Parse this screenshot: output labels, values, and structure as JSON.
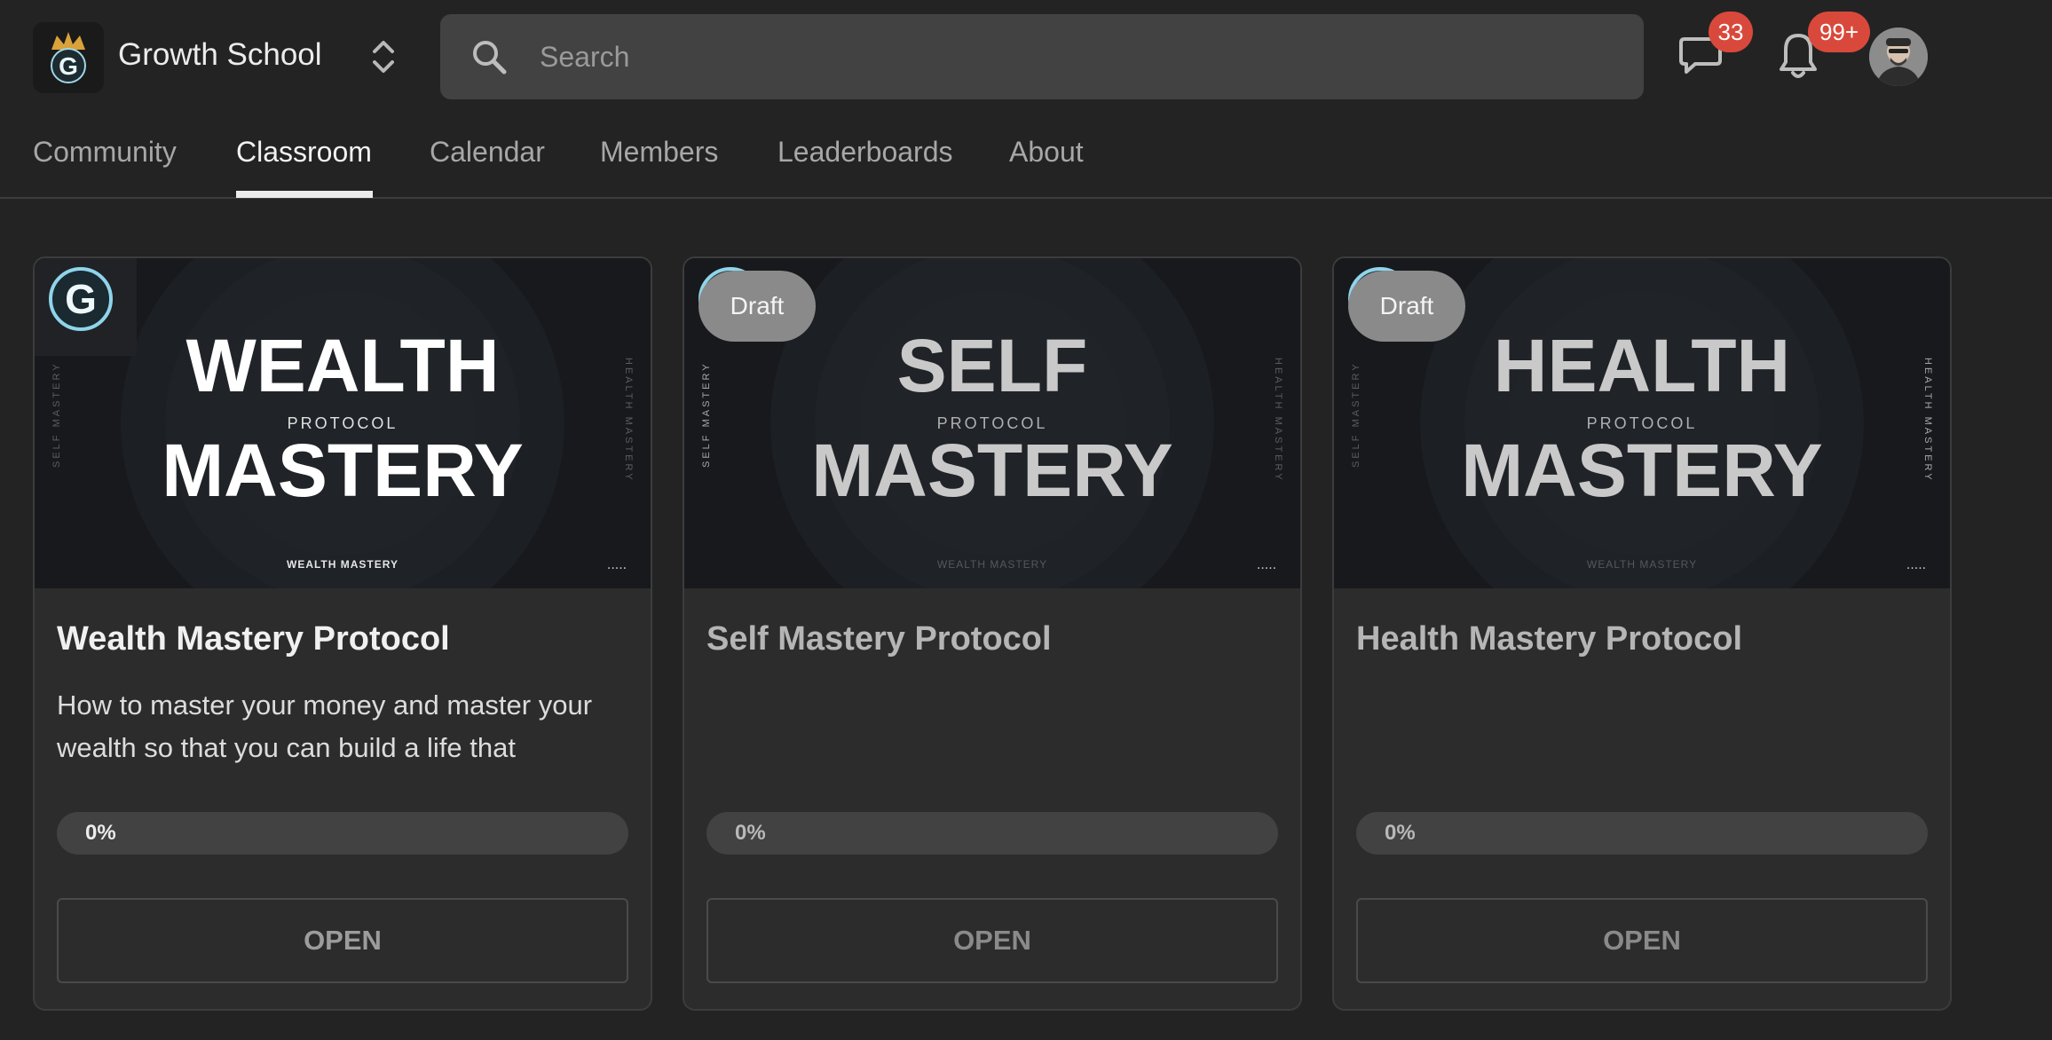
{
  "header": {
    "app_name": "Growth School",
    "search_placeholder": "Search",
    "chat_badge": "33",
    "notification_badge": "99+"
  },
  "tabs": [
    {
      "label": "Community"
    },
    {
      "label": "Classroom",
      "active": true
    },
    {
      "label": "Calendar"
    },
    {
      "label": "Members"
    },
    {
      "label": "Leaderboards"
    },
    {
      "label": "About"
    }
  ],
  "courses": [
    {
      "title": "Wealth Mastery Protocol",
      "description": "How to master your money and master your wealth so that you can build a life that",
      "progress_label": "0%",
      "progress": 0,
      "open_label": "OPEN",
      "draft": false,
      "thumbnail": {
        "headline": "WEALTH",
        "sub": "PROTOCOL",
        "headline2": "MASTERY",
        "footer": "WEALTH MASTERY",
        "side_left": "SELF MASTERY",
        "side_right": "HEALTH MASTERY",
        "logo_letter": "G"
      }
    },
    {
      "title": "Self Mastery Protocol",
      "description": "",
      "progress_label": "0%",
      "progress": 0,
      "open_label": "OPEN",
      "draft": true,
      "draft_label": "Draft",
      "thumbnail": {
        "headline": "SELF",
        "sub": "PROTOCOL",
        "headline2": "MASTERY",
        "footer": "WEALTH MASTERY",
        "side_left": "SELF MASTERY",
        "side_right": "HEALTH MASTERY"
      }
    },
    {
      "title": "Health Mastery Protocol",
      "description": "",
      "progress_label": "0%",
      "progress": 0,
      "open_label": "OPEN",
      "draft": true,
      "draft_label": "Draft",
      "thumbnail": {
        "headline": "HEALTH",
        "sub": "PROTOCOL",
        "headline2": "MASTERY",
        "footer": "WEALTH MASTERY",
        "side_left": "SELF MASTERY",
        "side_right": "HEALTH MASTERY"
      }
    }
  ],
  "colors": {
    "background": "#232323",
    "card": "#2c2c2c",
    "badge": "#d9493b",
    "draft_badge": "#8a8a8a"
  }
}
